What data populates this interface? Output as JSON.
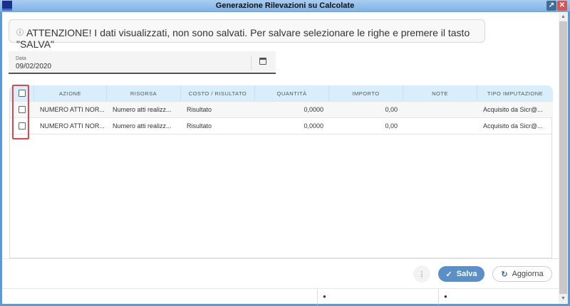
{
  "window": {
    "title": "Generazione Rilevazioni su Calcolate"
  },
  "alert": {
    "icon": "info-circle-icon",
    "text": "ATTENZIONE! I dati visualizzati, non sono salvati. Per salvare selezionare le righe e premere il tasto \"SALVA\""
  },
  "date_field": {
    "label": "Data",
    "value": "09/02/2020"
  },
  "table": {
    "columns": [
      "AZIONE",
      "RISORSA",
      "COSTO / RISULTATO",
      "QUANTITÀ",
      "IMPORTO",
      "NOTE",
      "TIPO IMPUTAZIONE"
    ],
    "rows": [
      {
        "azione": "NUMERO ATTI NOR...",
        "risorsa": "Numero atti realizz...",
        "costo": "Risultato",
        "quantita": "0,0000",
        "importo": "0,00",
        "note": "",
        "tipo": "Acquisito da Sicr@..."
      },
      {
        "azione": "NUMERO ATTI NOR...",
        "risorsa": "Numero atti realizz...",
        "costo": "Risultato",
        "quantita": "0,0000",
        "importo": "0,00",
        "note": "",
        "tipo": "Acquisito da Sicr@..."
      }
    ]
  },
  "buttons": {
    "more": "⋮",
    "save": "Salva",
    "refresh": "Aggiorna"
  },
  "colors": {
    "accent": "#5b8fc7",
    "header": "#d8eefa",
    "highlight": "#e0474c"
  }
}
